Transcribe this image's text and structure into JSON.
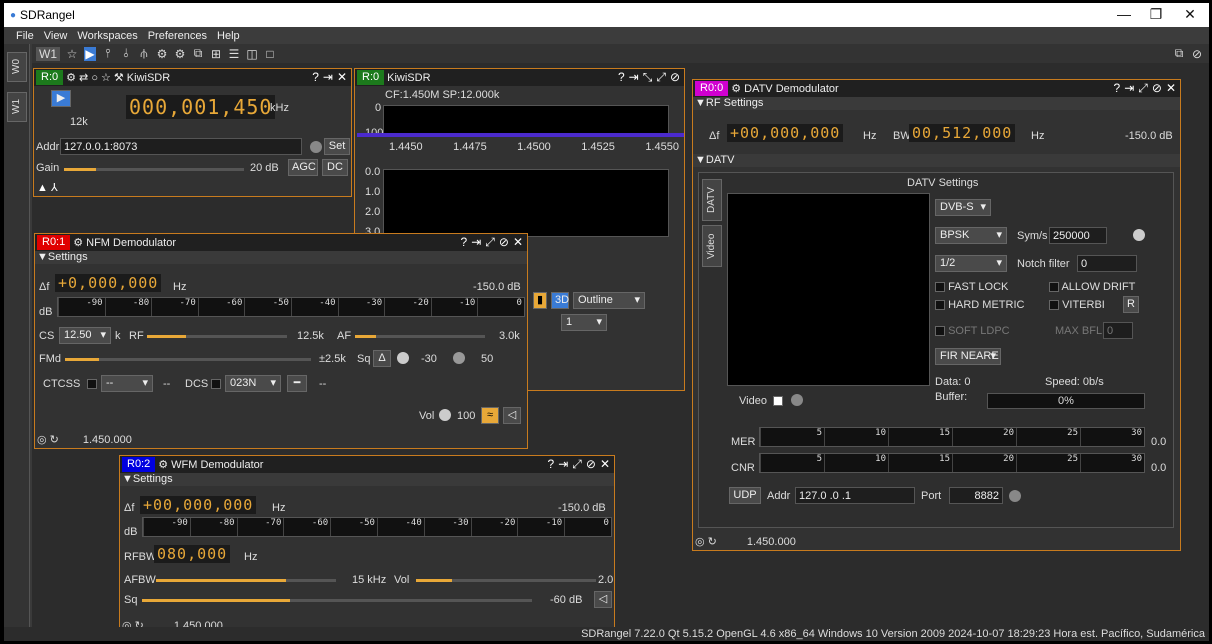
{
  "app": {
    "title": "SDRangel"
  },
  "menu": [
    "File",
    "View",
    "Workspaces",
    "Preferences",
    "Help"
  ],
  "sidebar": {
    "tabs": [
      "W0",
      "W1"
    ]
  },
  "toolbar": {
    "workspace": "W1"
  },
  "kiwi_dev": {
    "badge": "R:0",
    "title": "KiwiSDR",
    "freq": "000,001,450",
    "unit": "kHz",
    "sr": "12k",
    "addr_label": "Addr",
    "addr": "127.0.0.1:8073",
    "set": "Set",
    "gain_label": "Gain",
    "gain_value": "20 dB",
    "agc": "AGC",
    "dc": "DC",
    "gain": 0.18
  },
  "spectrum": {
    "badge": "R:0",
    "title": "KiwiSDR",
    "info": "CF:1.450M SP:12.000k",
    "y0": "0",
    "y100": "100",
    "ticks": [
      "1.4450",
      "1.4475",
      "1.4500",
      "1.4525",
      "1.4550"
    ],
    "wf_ticks": [
      "0.0",
      "1.0",
      "2.0",
      "3.0"
    ],
    "outline": "Outline",
    "stack": "1"
  },
  "nfm": {
    "badge": "R0:1",
    "title": "NFM Demodulator",
    "section": "Settings",
    "shift": "+0,000,000",
    "unit": "Hz",
    "power": "-150.0 dB",
    "db": "dB",
    "scale": [
      "-90",
      "-80",
      "-70",
      "-60",
      "-50",
      "-40",
      "-30",
      "-20",
      "-10",
      "0"
    ],
    "cs": "CS",
    "cs_val": "12.50",
    "k": "k",
    "rf": "RF",
    "rf_val": "12.5k",
    "af": "AF",
    "af_val": "3.0k",
    "fmd": "FMd",
    "fmd_val": "±2.5k",
    "sq": "Sq",
    "sq_val": "-30",
    "sq_gate": "50",
    "ctcss": "CTCSS",
    "ctcss_val": "--",
    "ctcss_dash": "--",
    "dcs": "DCS",
    "dcs_val": "023N",
    "dcs_dash": "--",
    "vol": "Vol",
    "vol_val": "100",
    "freq": "1.450.000"
  },
  "wfm": {
    "badge": "R0:2",
    "title": "WFM Demodulator",
    "section": "Settings",
    "shift": "+00,000,000",
    "unit": "Hz",
    "power": "-150.0 dB",
    "db": "dB",
    "scale": [
      "-90",
      "-80",
      "-70",
      "-60",
      "-50",
      "-40",
      "-30",
      "-20",
      "-10",
      "0"
    ],
    "rfbw": "RFBW",
    "rfbw_val": "080,000",
    "afbw": "AFBW",
    "afbw_val": "15 kHz",
    "vol": "Vol",
    "vol_val": "2.0",
    "sq": "Sq",
    "sq_val": "-60 dB",
    "freq": "1.450.000"
  },
  "datv": {
    "badge": "R0:0",
    "title": "DATV Demodulator",
    "rf_section": "RF Settings",
    "shift": "+00,000,000",
    "unit": "Hz",
    "bw_label": "BW",
    "bw": "00,512,000",
    "power": "-150.0 dB",
    "datv_section": "DATV",
    "settings_title": "DATV Settings",
    "tabs": [
      "DATV",
      "Video"
    ],
    "std": "DVB-S",
    "mod": "BPSK",
    "syms_label": "Sym/s",
    "syms": "250000",
    "fec": "1/2",
    "notch_label": "Notch filter",
    "notch": "0",
    "fast_lock": "FAST LOCK",
    "allow_drift": "ALLOW DRIFT",
    "hard_metric": "HARD METRIC",
    "viterbi": "VITERBI",
    "r": "R",
    "soft_ldpc": "SOFT LDPC",
    "max_bfl": "MAX BFL",
    "max_bfl_val": "0",
    "fir": "FIR NEARE",
    "data": "Data: 0",
    "speed": "Speed: 0b/s",
    "video": "Video",
    "buffer": "Buffer:",
    "buffer_val": "0%",
    "mer": "MER",
    "cnr": "CNR",
    "mer_val": "0.0",
    "cnr_val": "0.0",
    "mer_scale": [
      "5",
      "10",
      "15",
      "20",
      "25",
      "30"
    ],
    "udp": "UDP",
    "addr_label": "Addr",
    "addr": "127.0 .0 .1",
    "port_label": "Port",
    "port": "8882",
    "freq": "1.450.000"
  },
  "status": "SDRangel 7.22.0 Qt 5.15.2 OpenGL 4.6 x86_64 Windows 10 Version 2009  2024-10-07 18:29:23 Hora est. Pacífico, Sudamérica",
  "colors": {
    "accent": "#e8a838",
    "border": "#c87b1e",
    "nfm_badge": "#e00000",
    "wfm_badge": "#0000e0",
    "datv_badge": "#d000d0",
    "dev_badge": "#1c7a1c"
  }
}
